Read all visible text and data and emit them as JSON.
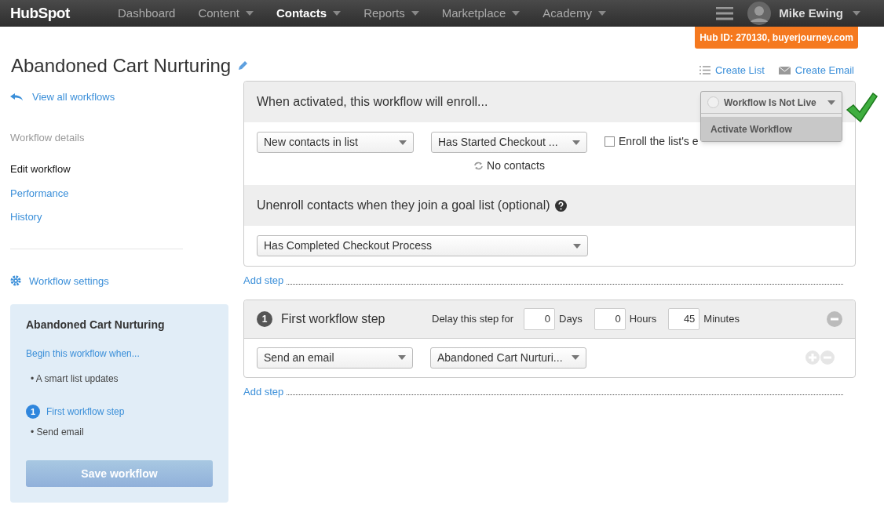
{
  "nav": {
    "logo": "HubSpot",
    "items": [
      {
        "label": "Dashboard",
        "selected": false,
        "caret": false
      },
      {
        "label": "Content",
        "selected": false,
        "caret": true
      },
      {
        "label": "Contacts",
        "selected": true,
        "caret": true
      },
      {
        "label": "Reports",
        "selected": false,
        "caret": true
      },
      {
        "label": "Marketplace",
        "selected": false,
        "caret": true
      },
      {
        "label": "Academy",
        "selected": false,
        "caret": true
      }
    ],
    "user": "Mike Ewing",
    "hub_id": "Hub ID: 270130, buyerjourney.com"
  },
  "page": {
    "title": "Abandoned Cart Nurturing",
    "actions": [
      {
        "kind": "list",
        "label": "Create List"
      },
      {
        "kind": "email",
        "label": "Create Email"
      }
    ]
  },
  "sidebar": {
    "back_link": "View all workflows",
    "section_label": "Workflow details",
    "items": [
      {
        "label": "Edit workflow",
        "selected": true
      },
      {
        "label": "Performance",
        "selected": false
      },
      {
        "label": "History",
        "selected": false
      }
    ],
    "settings_link": "Workflow settings",
    "summary": {
      "title": "Abandoned Cart Nurturing",
      "trigger_link": "Begin this workflow when...",
      "trigger_item": "• A smart list updates",
      "step_number": "1",
      "step_link": "First workflow step",
      "step_item": "• Send email",
      "save_button": {
        "label": "Save workflow",
        "disabled": true
      }
    }
  },
  "enroll": {
    "header": "When activated, this workflow will enroll...",
    "status": {
      "label": "Workflow Is Not Live",
      "live": false,
      "menu_item": "Activate Workflow"
    },
    "list_type": "New contacts in list",
    "list": "Has Started Checkout ...",
    "sync": "No contacts",
    "checkbox": {
      "label": "Enroll the list's e",
      "checked": false
    },
    "goal_header": "Unenroll contacts when they join a goal list (optional)",
    "goal_list": "Has Completed Checkout Process"
  },
  "add_step_links": [
    "Add step",
    "Add step"
  ],
  "step": {
    "number": "1",
    "title": "First workflow step",
    "delay_label": "Delay this step for",
    "delays": [
      {
        "value": "0",
        "unit": "Days"
      },
      {
        "value": "0",
        "unit": "Hours"
      },
      {
        "value": "45",
        "unit": "Minutes"
      }
    ],
    "action": "Send an email",
    "email": "Abandoned Cart Nurturi..."
  }
}
